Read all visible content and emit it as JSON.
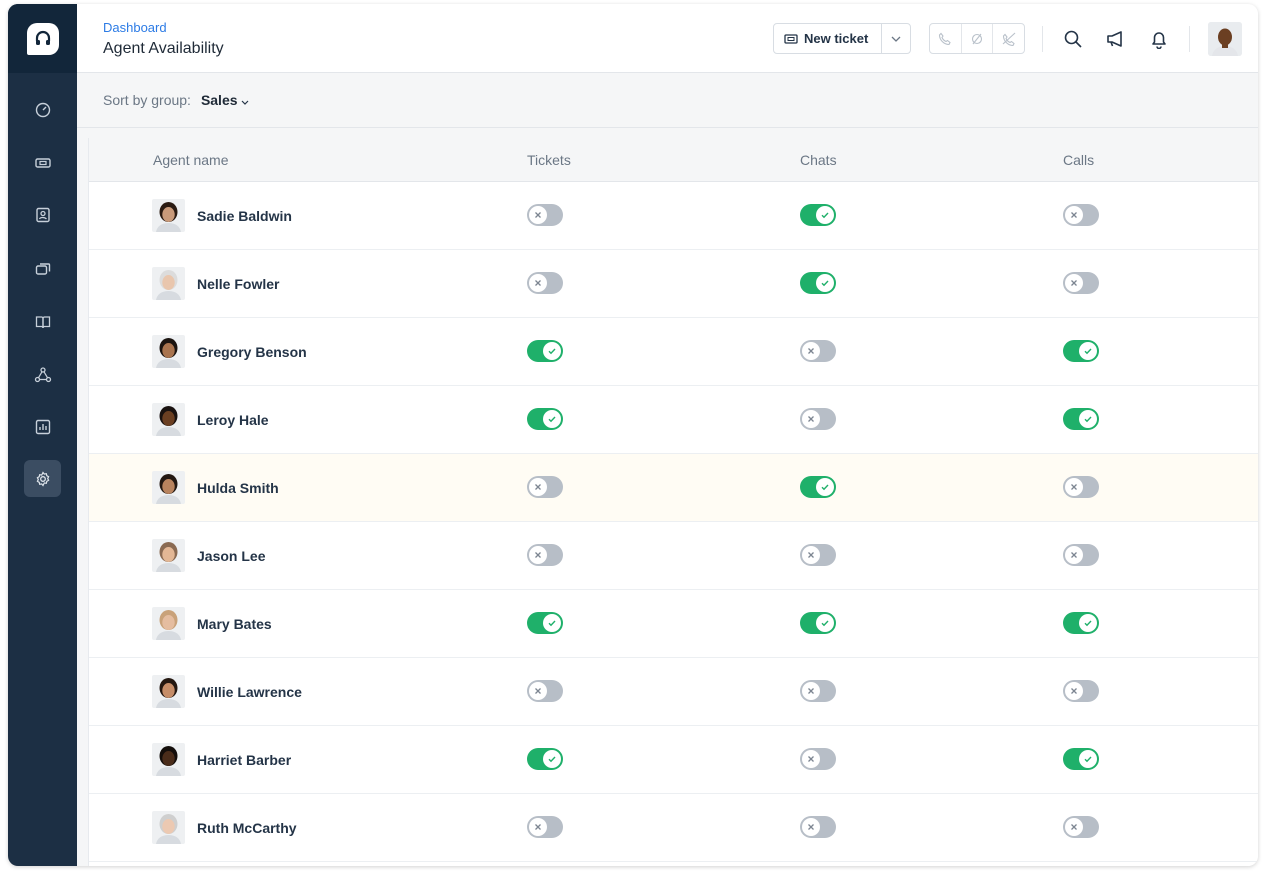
{
  "header": {
    "breadcrumb": "Dashboard",
    "title": "Agent Availability",
    "new_ticket_label": "New ticket"
  },
  "sidebar": {
    "items": [
      {
        "icon": "dashboard-icon",
        "active": false
      },
      {
        "icon": "ticket-icon",
        "active": false
      },
      {
        "icon": "contacts-icon",
        "active": false
      },
      {
        "icon": "conversations-icon",
        "active": false
      },
      {
        "icon": "knowledge-base-icon",
        "active": false
      },
      {
        "icon": "social-icon",
        "active": false
      },
      {
        "icon": "reports-icon",
        "active": false
      },
      {
        "icon": "settings-icon",
        "active": true
      }
    ]
  },
  "sort": {
    "label": "Sort by group:",
    "value": "Sales"
  },
  "table": {
    "columns": [
      "Agent name",
      "Tickets",
      "Chats",
      "Calls"
    ],
    "rows": [
      {
        "name": "Sadie Baldwin",
        "tickets": false,
        "chats": true,
        "calls": false
      },
      {
        "name": "Nelle Fowler",
        "tickets": false,
        "chats": true,
        "calls": false
      },
      {
        "name": "Gregory Benson",
        "tickets": true,
        "chats": false,
        "calls": true
      },
      {
        "name": "Leroy Hale",
        "tickets": true,
        "chats": false,
        "calls": true
      },
      {
        "name": "Hulda Smith",
        "tickets": false,
        "chats": true,
        "calls": false,
        "highlighted": true
      },
      {
        "name": "Jason Lee",
        "tickets": false,
        "chats": false,
        "calls": false
      },
      {
        "name": "Mary Bates",
        "tickets": true,
        "chats": true,
        "calls": true
      },
      {
        "name": "Willie Lawrence",
        "tickets": false,
        "chats": false,
        "calls": false
      },
      {
        "name": "Harriet Barber",
        "tickets": true,
        "chats": false,
        "calls": true
      },
      {
        "name": "Ruth McCarthy",
        "tickets": false,
        "chats": false,
        "calls": false
      }
    ]
  },
  "colors": {
    "sidebar": "#1c2f44",
    "toggle_on": "#1fb06a",
    "toggle_off": "#b7bec7",
    "link": "#2c7be5"
  }
}
